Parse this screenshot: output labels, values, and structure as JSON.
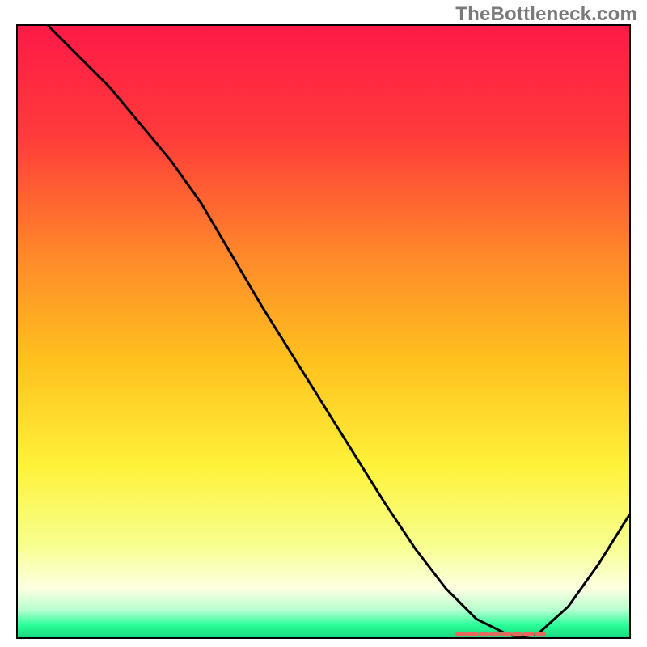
{
  "watermark": "TheBottleneck.com",
  "colors": {
    "gradient_stops": [
      {
        "offset": 0.0,
        "color": "#ff1a48"
      },
      {
        "offset": 0.18,
        "color": "#ff3b3a"
      },
      {
        "offset": 0.38,
        "color": "#ff8a2a"
      },
      {
        "offset": 0.55,
        "color": "#ffc21e"
      },
      {
        "offset": 0.72,
        "color": "#fff23a"
      },
      {
        "offset": 0.85,
        "color": "#f7ff8f"
      },
      {
        "offset": 0.92,
        "color": "#fdffe0"
      },
      {
        "offset": 0.955,
        "color": "#b7ffcf"
      },
      {
        "offset": 0.98,
        "color": "#2aff99"
      },
      {
        "offset": 1.0,
        "color": "#18d97e"
      }
    ],
    "dash_stroke": "#e2695c"
  },
  "chart_data": {
    "type": "line",
    "title": "",
    "xlabel": "",
    "ylabel": "",
    "xlim": [
      0,
      100
    ],
    "ylim": [
      0,
      100
    ],
    "grid": false,
    "legend": false,
    "series": [
      {
        "name": "bottleneck-curve",
        "x": [
          5,
          10,
          15,
          20,
          25,
          30,
          35,
          40,
          45,
          50,
          55,
          60,
          65,
          70,
          75,
          80,
          82,
          85,
          90,
          95,
          100
        ],
        "y": [
          100,
          95,
          90,
          84,
          78,
          71,
          62.5,
          54,
          46,
          38,
          30,
          22,
          14.5,
          8,
          3,
          0.5,
          0,
          0.5,
          5,
          12,
          20
        ]
      }
    ],
    "annotations": [
      {
        "name": "optimal-range-marker",
        "kind": "dashed-segment",
        "y": 0.5,
        "x_start": 72,
        "x_end": 86
      }
    ]
  }
}
